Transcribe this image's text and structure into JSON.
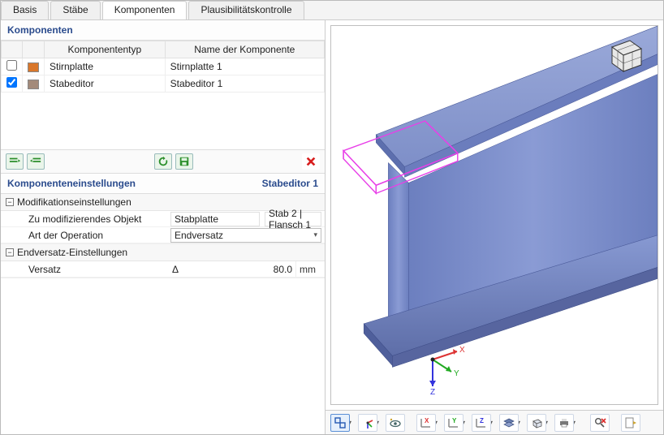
{
  "tabs": [
    "Basis",
    "Stäbe",
    "Komponenten",
    "Plausibilitätskontrolle"
  ],
  "activeTabIndex": 2,
  "componentsPanel": {
    "title": "Komponenten",
    "columns": {
      "type": "Komponententyp",
      "name": "Name der Komponente"
    },
    "rows": [
      {
        "checked": false,
        "swatch": "orange",
        "type": "Stirnplatte",
        "name": "Stirnplatte 1"
      },
      {
        "checked": true,
        "swatch": "brown",
        "type": "Stabeditor",
        "name": "Stabeditor 1"
      }
    ],
    "toolbar": {
      "addRow": "add-row",
      "removeRow": "remove-row",
      "refresh": "refresh",
      "save": "save",
      "deleteX": "delete"
    }
  },
  "settingsPanel": {
    "title": "Komponenteneinstellungen",
    "subject": "Stabeditor 1",
    "groups": [
      {
        "title": "Modifikationseinstellungen",
        "rows": [
          {
            "label": "Zu modifizierendes Objekt",
            "kind": "dual",
            "v1": "Stabplatte",
            "v2": "Stab 2 | Flansch 1"
          },
          {
            "label": "Art der Operation",
            "kind": "dropdown",
            "v1": "Endversatz"
          }
        ]
      },
      {
        "title": "Endversatz-Einstellungen",
        "rows": [
          {
            "label": "Versatz",
            "kind": "numeric",
            "delta": "Δ",
            "value": "80.0",
            "unit": "mm"
          }
        ]
      }
    ]
  },
  "viewport": {
    "axes": {
      "x": "X",
      "y": "Y",
      "z": "Z"
    }
  },
  "viewToolbar": {
    "buttons": [
      "select-mode",
      "axes-toggle",
      "view-eye",
      "sep",
      "axis-x",
      "axis-y",
      "axis-z",
      "layers",
      "box-view",
      "print",
      "sep",
      "search-cancel",
      "sep",
      "next-view"
    ]
  }
}
